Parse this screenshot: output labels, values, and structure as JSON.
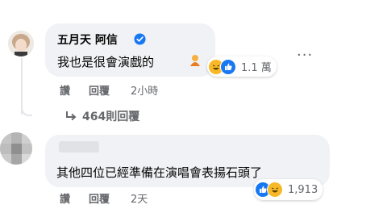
{
  "comment1": {
    "author": "五月天 阿信",
    "verified_icon": "verified-badge-icon",
    "text": "我也是很會演戲的",
    "emoji_icon": "person-bowing-emoji",
    "reaction_count": "1.1 萬",
    "reactions": [
      "haha-emoji",
      "like-emoji"
    ],
    "actions": {
      "like": "讚",
      "reply": "回覆",
      "time": "2小時"
    },
    "more_icon": "more-options-icon"
  },
  "replies_link": {
    "arrow_icon": "reply-arrow-icon",
    "label": "464則回覆"
  },
  "comment2": {
    "author_blurred": "",
    "text": "其他四位已經準備在演唱會表揚石頭了",
    "reaction_count": "1,913",
    "reactions": [
      "like-emoji",
      "haha-emoji"
    ],
    "actions": {
      "like": "讚",
      "reply": "回覆",
      "time": "2天"
    }
  },
  "colors": {
    "bubble": "#f0f2f5",
    "meta": "#65676b",
    "like": "#1877f2",
    "haha": "#f7b928",
    "verified": "#1877f2"
  }
}
